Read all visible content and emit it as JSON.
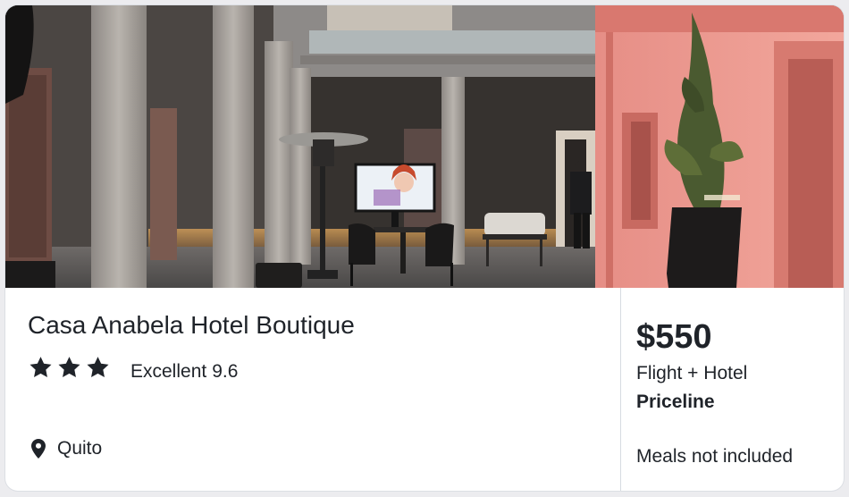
{
  "hotel": {
    "name": "Casa Anabela Hotel Boutique",
    "stars": 3,
    "rating_label": "Excellent",
    "rating_score": "9.6",
    "location": "Quito",
    "location_icon": "map-pin-icon",
    "star_icon": "star-icon"
  },
  "offer": {
    "price": "$550",
    "package": "Flight + Hotel",
    "provider": "Priceline",
    "meals": "Meals not included"
  },
  "colors": {
    "text": "#1f2329",
    "divider": "#d6dbe1",
    "card_bg": "#ffffff",
    "page_bg": "#ececef"
  }
}
